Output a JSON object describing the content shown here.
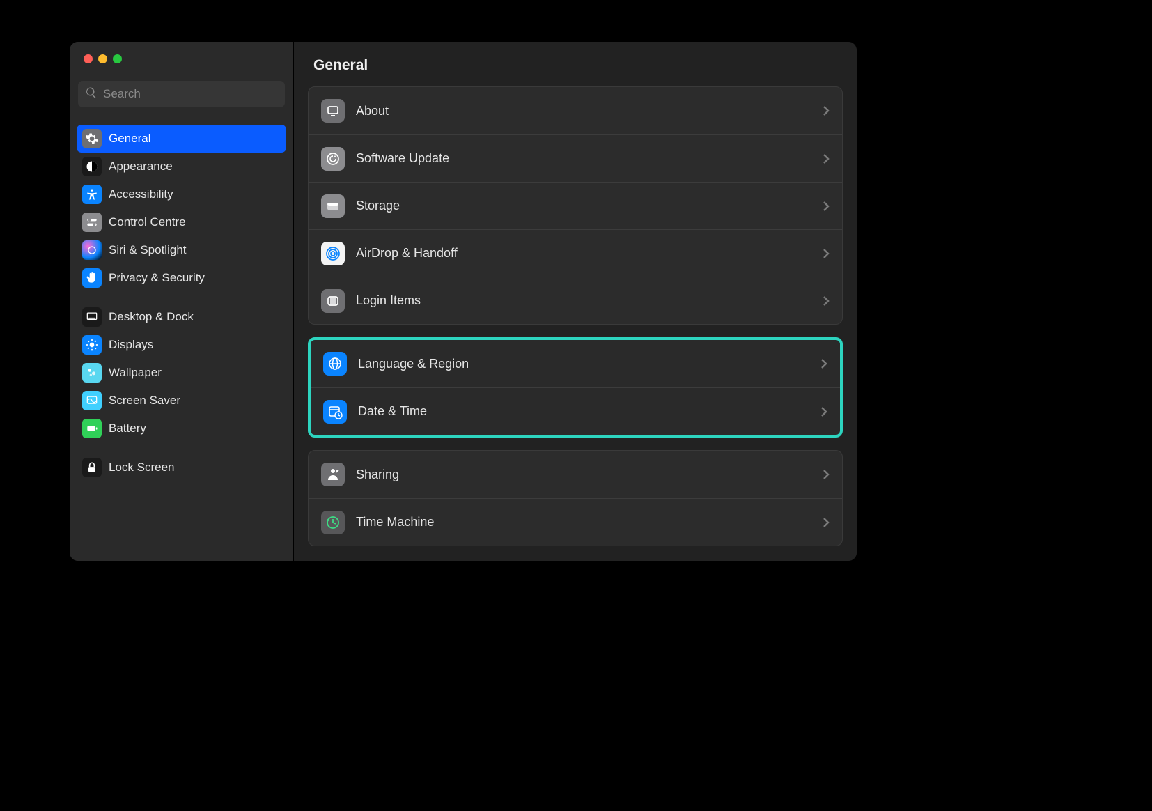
{
  "search": {
    "placeholder": "Search"
  },
  "sidebar": {
    "items": [
      {
        "label": "General"
      },
      {
        "label": "Appearance"
      },
      {
        "label": "Accessibility"
      },
      {
        "label": "Control Centre"
      },
      {
        "label": "Siri & Spotlight"
      },
      {
        "label": "Privacy & Security"
      },
      {
        "label": "Desktop & Dock"
      },
      {
        "label": "Displays"
      },
      {
        "label": "Wallpaper"
      },
      {
        "label": "Screen Saver"
      },
      {
        "label": "Battery"
      },
      {
        "label": "Lock Screen"
      }
    ]
  },
  "main": {
    "title": "General",
    "groups": [
      {
        "highlight": false,
        "rows": [
          {
            "label": "About",
            "icon": "about-icon"
          },
          {
            "label": "Software Update",
            "icon": "software-update-icon"
          },
          {
            "label": "Storage",
            "icon": "storage-icon"
          },
          {
            "label": "AirDrop & Handoff",
            "icon": "airdrop-icon"
          },
          {
            "label": "Login Items",
            "icon": "login-items-icon"
          }
        ]
      },
      {
        "highlight": true,
        "rows": [
          {
            "label": "Language & Region",
            "icon": "language-icon"
          },
          {
            "label": "Date & Time",
            "icon": "date-time-icon"
          }
        ]
      },
      {
        "highlight": false,
        "rows": [
          {
            "label": "Sharing",
            "icon": "sharing-icon"
          },
          {
            "label": "Time Machine",
            "icon": "time-machine-icon"
          }
        ]
      }
    ]
  },
  "colors": {
    "highlight_border": "#2dd4bf",
    "selected_bg": "#0a5cff"
  }
}
